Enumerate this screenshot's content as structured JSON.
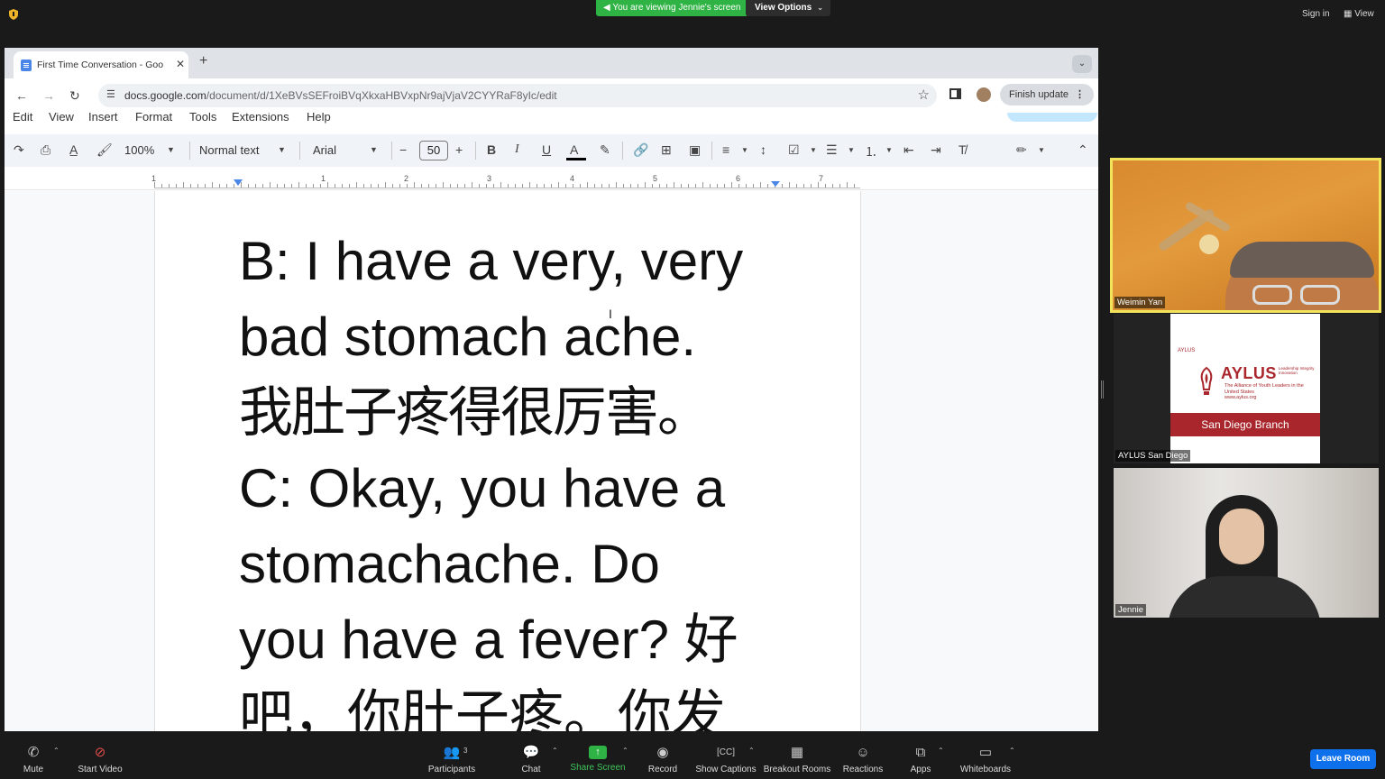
{
  "zoom_top": {
    "viewing_banner": "You are viewing Jennie's screen",
    "view_options": "View Options",
    "sign_in": "Sign in",
    "view": "View"
  },
  "browser": {
    "tab_title": "First Time Conversation - Goo",
    "url_host": "docs.google.com",
    "url_path": "/document/d/1XeBVsSEFroiBVqXkxaHBVxpNr9ajVjaV2CYYRaF8yIc/edit",
    "finish_update": "Finish update"
  },
  "docs": {
    "menu": [
      "Edit",
      "View",
      "Insert",
      "Format",
      "Tools",
      "Extensions",
      "Help"
    ],
    "toolbar": {
      "zoom": "100%",
      "style": "Normal text",
      "font": "Arial",
      "font_size": "50"
    },
    "ruler_numbers": [
      "1",
      "1",
      "2",
      "3",
      "4",
      "5",
      "6",
      "7"
    ],
    "lines": [
      "B: I have a very, very",
      "bad stomach ache.",
      "我肚子疼得很厉害。",
      "C: Okay, you have a",
      "stomachache. Do",
      "you have a fever? 好",
      "吧，你肚子疼。你发"
    ]
  },
  "participants": [
    {
      "name": "Weimin Yan",
      "active_speaker": true
    },
    {
      "name": "AYLUS San Diego"
    },
    {
      "name": "Jennie"
    }
  ],
  "aylus_card": {
    "small_logo": "AYLUS",
    "wordmark": "AYLUS",
    "tagline": "Leadership Integrity Innovation",
    "subtitle": "The Alliance of Youth Leaders in the United States",
    "site": "www.aylus.org",
    "branch": "San Diego Branch"
  },
  "zoom_bottom": {
    "mute": "Mute",
    "start_video": "Start Video",
    "participants": "Participants",
    "participants_count": "3",
    "chat": "Chat",
    "share_screen": "Share Screen",
    "record": "Record",
    "show_captions": "Show Captions",
    "breakout_rooms": "Breakout Rooms",
    "reactions": "Reactions",
    "apps": "Apps",
    "whiteboards": "Whiteboards",
    "leave_room": "Leave Room"
  },
  "colors": {
    "zoom_green": "#2fb344",
    "active_speaker_border": "#f2e35c",
    "leave_blue": "#0e71eb",
    "aylus_red": "#a8262c"
  }
}
